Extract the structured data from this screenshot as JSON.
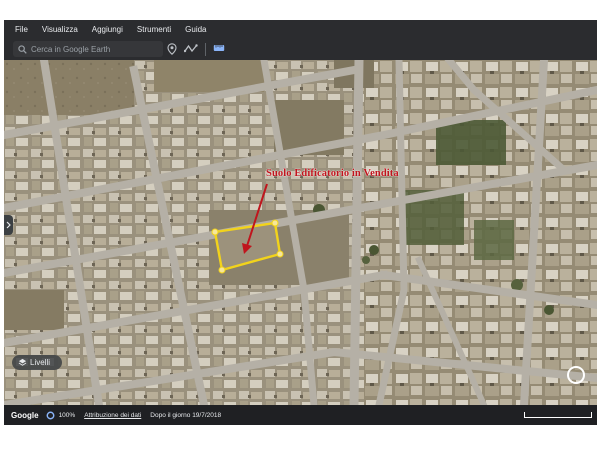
{
  "menu": [
    "File",
    "Visualizza",
    "Aggiungi",
    "Strumenti",
    "Guida"
  ],
  "toolbar": {
    "search_placeholder": "Cerca in Google Earth",
    "icons": [
      "search-icon",
      "location-pin-icon",
      "path-icon",
      "ruler-icon"
    ]
  },
  "map": {
    "annotation": "Suolo Edificatorio in Vendita",
    "annotation_color": "#c0151d",
    "highlight_color": "#f2d31b",
    "layers_label": "Livelli"
  },
  "status": {
    "logo": "Google",
    "zoom": "100%",
    "attribution": "Attribuzione dei dati",
    "imagery_date": "Dopo il giorno 19/7/2018"
  }
}
